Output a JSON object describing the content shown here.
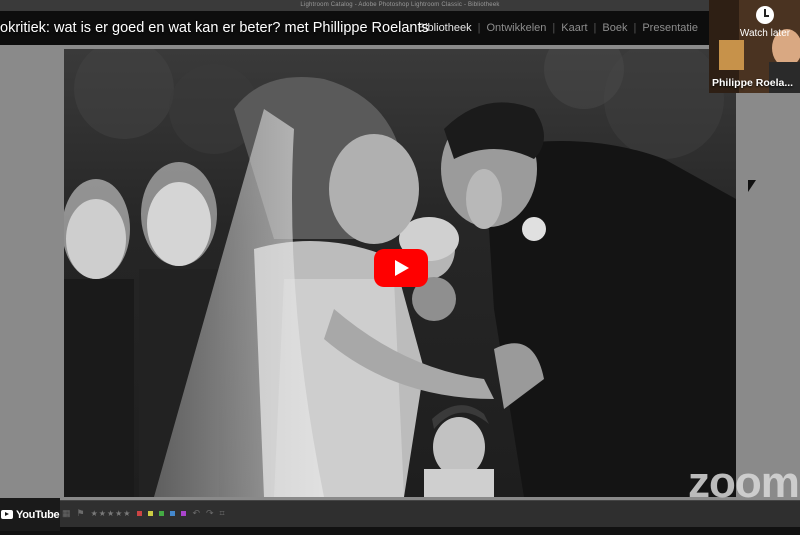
{
  "window": {
    "title": "Lightroom Catalog - Adobe Photoshop Lightroom Classic - Bibliotheek"
  },
  "video": {
    "title": "okritiek: wat is er goed en wat kan er beter? met Phillippe Roelants"
  },
  "modules": {
    "items": [
      {
        "label": "Bibliotheek",
        "active": true
      },
      {
        "label": "Ontwikkelen",
        "active": false
      },
      {
        "label": "Kaart",
        "active": false
      },
      {
        "label": "Boek",
        "active": false
      },
      {
        "label": "Presentatie",
        "active": false
      }
    ]
  },
  "zoom_tile": {
    "participant_name": "Philippe Roela...",
    "watch_later_label": "Watch later"
  },
  "watermark": {
    "text": "zoom"
  },
  "youtube": {
    "label": "YouTube"
  },
  "toolbar": {
    "stars": "★★★★★",
    "color_labels": [
      "#c44",
      "#cc4",
      "#4a4",
      "#48c",
      "#a4c"
    ]
  },
  "colors": {
    "play_button": "#ff0000",
    "workspace": "#8a8a8a",
    "header": "#0d0d0d"
  },
  "icons": {
    "play": "play-icon",
    "clock": "clock-icon",
    "youtube": "youtube-logo-icon",
    "cursor": "mouse-cursor-icon"
  }
}
